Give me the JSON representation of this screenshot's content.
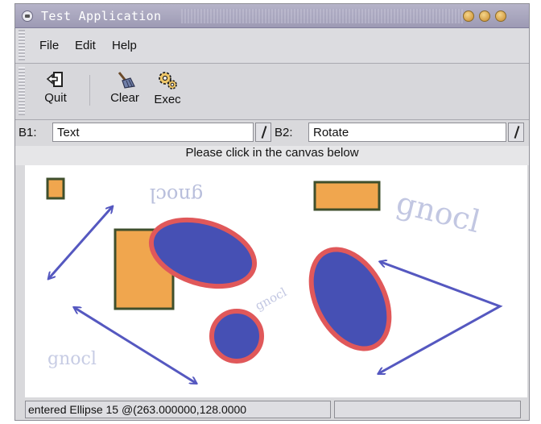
{
  "window": {
    "title": "Test Application"
  },
  "menubar": {
    "items": [
      "File",
      "Edit",
      "Help"
    ]
  },
  "toolbar": {
    "quit_label": "Quit",
    "clear_label": "Clear",
    "exec_label": "Exec"
  },
  "selectors": {
    "b1": {
      "label": "B1:",
      "value": "Text"
    },
    "b2": {
      "label": "B2:",
      "value": "Rotate"
    }
  },
  "prompt": "Please click in the canvas below",
  "canvas": {
    "text_items": [
      "gnocl",
      "gnocl",
      "gnocl",
      "gnocl"
    ],
    "colors": {
      "rect_fill": "#f0a64e",
      "rect_stroke": "#3f4f2c",
      "ellipse_fill": "#4650b4",
      "ellipse_stroke": "#e0585a",
      "arrow": "#5558c0",
      "text": "#b9bfdc"
    }
  },
  "statusbar": {
    "text": "entered Ellipse 15 @(263.000000,128.0000"
  }
}
